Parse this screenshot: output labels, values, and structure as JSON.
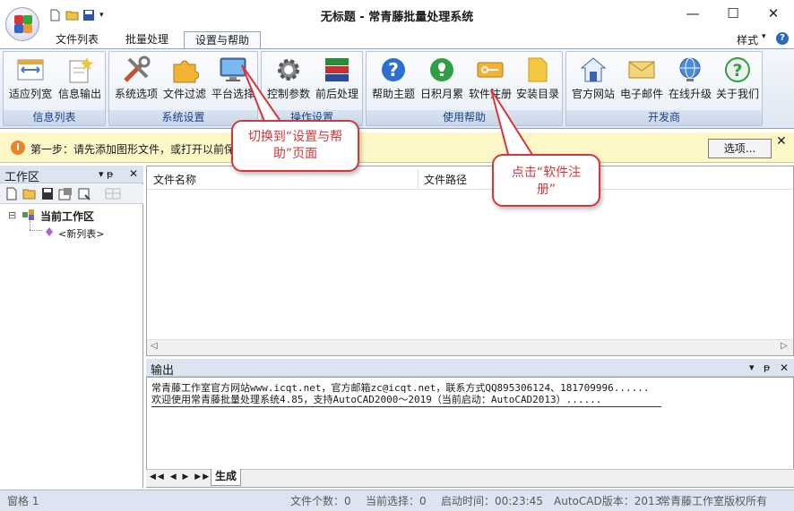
{
  "window": {
    "title": "无标题 - 常青藤批量处理系统",
    "minimize": "—",
    "maximize": "☐",
    "close": "✕"
  },
  "tabs": [
    {
      "label": "文件列表"
    },
    {
      "label": "批量处理"
    },
    {
      "label": "设置与帮助"
    }
  ],
  "style_menu": {
    "label": "样式",
    "arrow": "▾",
    "help": "?"
  },
  "ribbon": {
    "groups": [
      {
        "title": "信息列表",
        "buttons": [
          {
            "label": "适应列宽",
            "icon": "fit-columns-icon"
          },
          {
            "label": "信息输出",
            "icon": "info-output-icon"
          }
        ]
      },
      {
        "title": "系统设置",
        "buttons": [
          {
            "label": "系统选项",
            "icon": "tools-icon"
          },
          {
            "label": "文件过滤",
            "icon": "puzzle-icon"
          },
          {
            "label": "平台选择",
            "icon": "monitor-icon"
          }
        ]
      },
      {
        "title": "操作设置",
        "buttons": [
          {
            "label": "控制参数",
            "icon": "gear-icon"
          },
          {
            "label": "前后处理",
            "icon": "layers-icon"
          }
        ]
      },
      {
        "title": "使用帮助",
        "buttons": [
          {
            "label": "帮助主题",
            "icon": "help-icon"
          },
          {
            "label": "日积月累",
            "icon": "lightbulb-icon"
          },
          {
            "label": "软件注册",
            "icon": "key-card-icon"
          },
          {
            "label": "安装目录",
            "icon": "folder-icon"
          }
        ]
      },
      {
        "title": "开发商",
        "buttons": [
          {
            "label": "官方网站",
            "icon": "house-icon"
          },
          {
            "label": "电子邮件",
            "icon": "envelope-icon"
          },
          {
            "label": "在线升级",
            "icon": "globe-icon"
          },
          {
            "label": "关于我们",
            "icon": "question-icon"
          }
        ]
      }
    ]
  },
  "infobar": {
    "text": "第一步：请先添加图形文件，或打开以前保",
    "options_button": "选项...",
    "close": "✕"
  },
  "workspace": {
    "title": "工作区",
    "pin": "▾ ᵽ",
    "close": "✕",
    "tree": {
      "root": "当前工作区",
      "child": "<新列表>"
    }
  },
  "filelist": {
    "columns": [
      "文件名称",
      "文件路径"
    ]
  },
  "output": {
    "title": "输出",
    "lines": [
      "常青藤工作室官方网站www.icqt.net，官方邮箱zc@icqt.net，联系方式QQ895306124、181709996......",
      "欢迎使用常青藤批量处理系统4.85，支持AutoCAD2000～2019（当前启动：AutoCAD2013）......"
    ],
    "tab": "生成",
    "nav": "◀◀ ◀ ▶ ▶▶"
  },
  "status": {
    "left": "窗格 1",
    "file_count": "文件个数：0",
    "selected": "当前选择：0",
    "start_time": "启动时间：00:23:45",
    "autocad_version": "AutoCAD版本：2013",
    "copyright": "常青藤工作室版权所有"
  },
  "callouts": {
    "first": "切换到“设置与帮助”页面",
    "second": "点击“软件注册”"
  },
  "colors": {
    "accent": "#2c67c4",
    "callout": "#d4373a",
    "ribbon_bg": "#dfe7f2",
    "infobar_bg": "#fdf7c8"
  }
}
